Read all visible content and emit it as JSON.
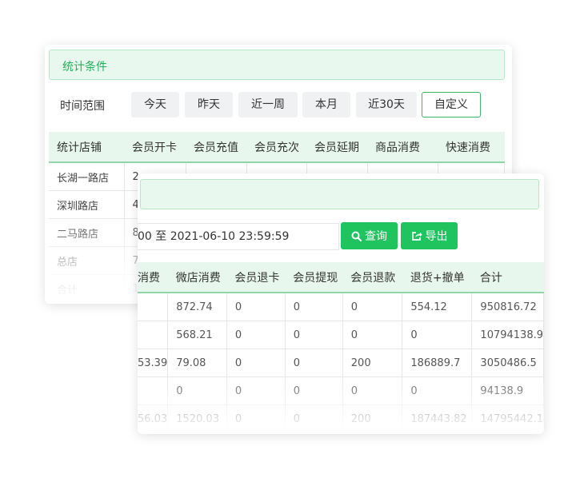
{
  "back_panel": {
    "condition_title": "统计条件",
    "time_label": "时间范围",
    "quick_buttons": [
      "今天",
      "昨天",
      "近一周",
      "本月",
      "近30天",
      "自定义"
    ],
    "active_button": "自定义",
    "table": {
      "headers": [
        "统计店铺",
        "会员开卡",
        "会员充值",
        "会员充次",
        "会员延期",
        "商品消费",
        "快速消费"
      ],
      "rows": [
        [
          "长湖一路店",
          "2",
          "",
          "",
          "",
          "",
          ""
        ],
        [
          "深圳路店",
          "4",
          "",
          "",
          "",
          "",
          ""
        ],
        [
          "二马路店",
          "8",
          "",
          "",
          "",
          "",
          ""
        ],
        [
          "总店",
          "7",
          "",
          "",
          "",
          "",
          ""
        ],
        [
          "合计",
          "1",
          "",
          "",
          "",
          "",
          ""
        ]
      ]
    }
  },
  "front_panel": {
    "date_range": "00 至 2021-06-10 23:59:59",
    "query_label": "查询",
    "export_label": "导出",
    "table": {
      "headers": [
        "消费",
        "微店消费",
        "会员退卡",
        "会员提现",
        "会员退款",
        "退货+撤单",
        "合计"
      ],
      "rows": [
        [
          "",
          "872.74",
          "0",
          "0",
          "0",
          "554.12",
          "950816.72"
        ],
        [
          "",
          "568.21",
          "0",
          "0",
          "0",
          "0",
          "10794138.9"
        ],
        [
          "53.39",
          "79.08",
          "0",
          "0",
          "200",
          "186889.7",
          "3050486.5"
        ],
        [
          "",
          "0",
          "0",
          "0",
          "0",
          "0",
          "94138.9"
        ],
        [
          "56.03",
          "1520.03",
          "0",
          "0",
          "200",
          "187443.82",
          "14795442.1"
        ]
      ]
    }
  },
  "colors": {
    "accent_green": "#1fc45e",
    "header_bg": "#e8f7ed",
    "condition_bg": "#e9f8ee"
  }
}
